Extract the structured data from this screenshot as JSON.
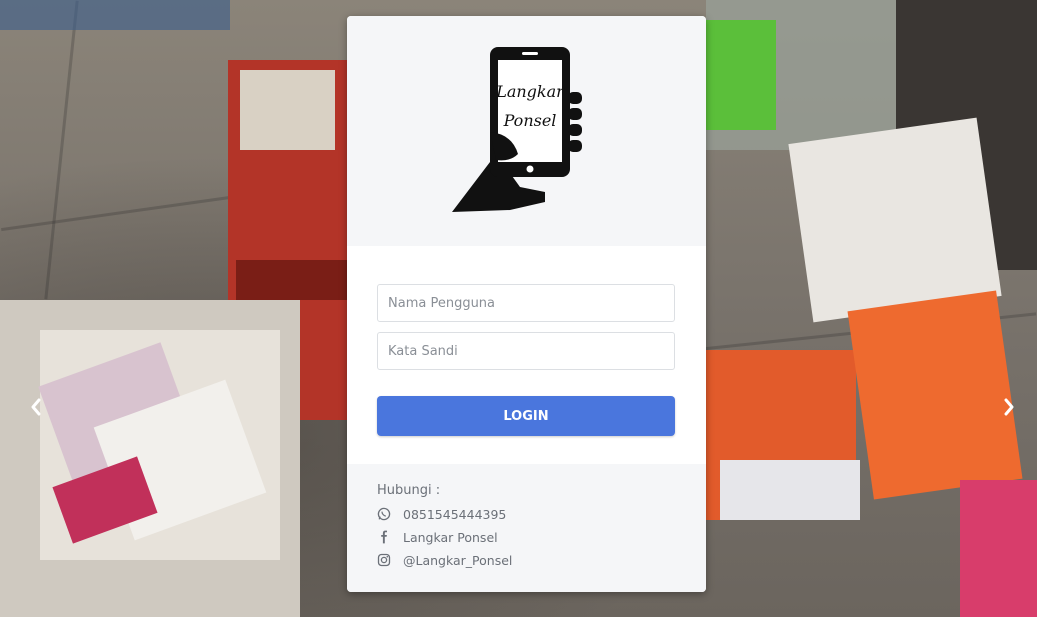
{
  "login_card": {
    "logo_text_line1": "Langkar",
    "logo_text_line2": "Ponsel",
    "username_placeholder": "Nama Pengguna",
    "password_placeholder": "Kata Sandi",
    "login_label": "LOGIN"
  },
  "contact": {
    "title": "Hubungi :",
    "phone": "0851545444395",
    "facebook": "Langkar Ponsel",
    "instagram": "@Langkar_Ponsel"
  },
  "carousel": {
    "prev_icon": "chevron-left-icon",
    "next_icon": "chevron-right-icon"
  },
  "colors": {
    "accent": "#4a76dd",
    "card_bg": "#ffffff",
    "panel_bg": "#f5f6f8"
  }
}
